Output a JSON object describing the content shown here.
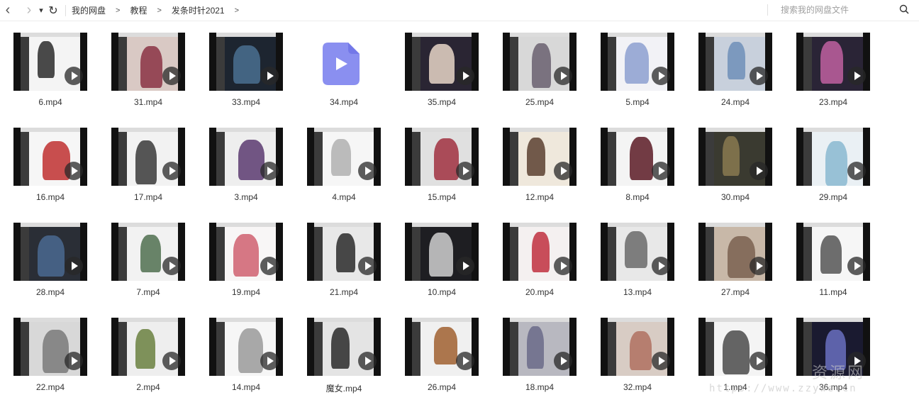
{
  "nav": {
    "back": "‹",
    "forward": "›",
    "dropdown": "▾",
    "refresh": "↻"
  },
  "breadcrumb": [
    "我的网盘",
    "教程",
    "发条时针2021"
  ],
  "breadcrumb_sep": ">",
  "search": {
    "placeholder": "搜索我的网盘文件",
    "value": ""
  },
  "files": [
    {
      "name": "6.mp4",
      "bg": "#f4f4f4",
      "art": "#2a2a2a"
    },
    {
      "name": "31.mp4",
      "bg": "#d9c9c4",
      "art": "#8a3344"
    },
    {
      "name": "33.mp4",
      "bg": "#1d2530",
      "art": "#4a7090"
    },
    {
      "name": "34.mp4",
      "icon": true
    },
    {
      "name": "35.mp4",
      "bg": "#2a2533",
      "art": "#e8d6c8"
    },
    {
      "name": "25.mp4",
      "bg": "#d8d8d8",
      "art": "#6a6070"
    },
    {
      "name": "5.mp4",
      "bg": "#f2f2f6",
      "art": "#8da0d0"
    },
    {
      "name": "24.mp4",
      "bg": "#c8d0dc",
      "art": "#6f8fb8"
    },
    {
      "name": "23.mp4",
      "bg": "#2a2436",
      "art": "#c060a0"
    },
    {
      "name": "16.mp4",
      "bg": "#f6f6f6",
      "art": "#c03030"
    },
    {
      "name": "17.mp4",
      "bg": "#f2f2f2",
      "art": "#3a3a3a"
    },
    {
      "name": "3.mp4",
      "bg": "#eeeeee",
      "art": "#5a3a70"
    },
    {
      "name": "4.mp4",
      "bg": "#f6f6f6",
      "art": "#b0b0b0"
    },
    {
      "name": "15.mp4",
      "bg": "#e0e0e0",
      "art": "#a03040"
    },
    {
      "name": "12.mp4",
      "bg": "#efe8dc",
      "art": "#5a4030"
    },
    {
      "name": "8.mp4",
      "bg": "#f4f4f4",
      "art": "#5a1a24"
    },
    {
      "name": "30.mp4",
      "bg": "#3a3a30",
      "art": "#8a7a50"
    },
    {
      "name": "29.mp4",
      "bg": "#eaf0f4",
      "art": "#8ab8d0"
    },
    {
      "name": "28.mp4",
      "bg": "#2a2e36",
      "art": "#4a6890"
    },
    {
      "name": "7.mp4",
      "bg": "#f2f2f2",
      "art": "#507050"
    },
    {
      "name": "19.mp4",
      "bg": "#f8f6f6",
      "art": "#d06070"
    },
    {
      "name": "21.mp4",
      "bg": "#e8e8e8",
      "art": "#2a2a2a"
    },
    {
      "name": "10.mp4",
      "bg": "#1e1e22",
      "art": "#d0d0d0"
    },
    {
      "name": "20.mp4",
      "bg": "#f4f0f0",
      "art": "#c03040"
    },
    {
      "name": "13.mp4",
      "bg": "#e8e8e8",
      "art": "#6a6a6a"
    },
    {
      "name": "27.mp4",
      "bg": "#c8b8a8",
      "art": "#7a6050"
    },
    {
      "name": "11.mp4",
      "bg": "#f6f6f6",
      "art": "#555555"
    },
    {
      "name": "22.mp4",
      "bg": "#d8d8d8",
      "art": "#7a7a7a"
    },
    {
      "name": "2.mp4",
      "bg": "#eeeeee",
      "art": "#6a8040"
    },
    {
      "name": "14.mp4",
      "bg": "#f6f6f6",
      "art": "#9a9a9a"
    },
    {
      "name": "魔女.mp4",
      "bg": "#e4e4e4",
      "art": "#2a2a2a"
    },
    {
      "name": "26.mp4",
      "bg": "#f0f0f0",
      "art": "#a06030"
    },
    {
      "name": "18.mp4",
      "bg": "#b8b8c0",
      "art": "#6a6a88"
    },
    {
      "name": "32.mp4",
      "bg": "#d8ccc4",
      "art": "#b07060"
    },
    {
      "name": "1.mp4",
      "bg": "#f4f4f4",
      "art": "#4a4a4a"
    },
    {
      "name": "36.mp4",
      "bg": "#1a1a30",
      "art": "#6a70c0"
    }
  ],
  "colors": {
    "icon_purple": "#8a8ff0",
    "icon_purple_dark": "#7378e8"
  },
  "watermark": {
    "line1": "资源网",
    "line2": "https://www.zzywe.cn"
  }
}
